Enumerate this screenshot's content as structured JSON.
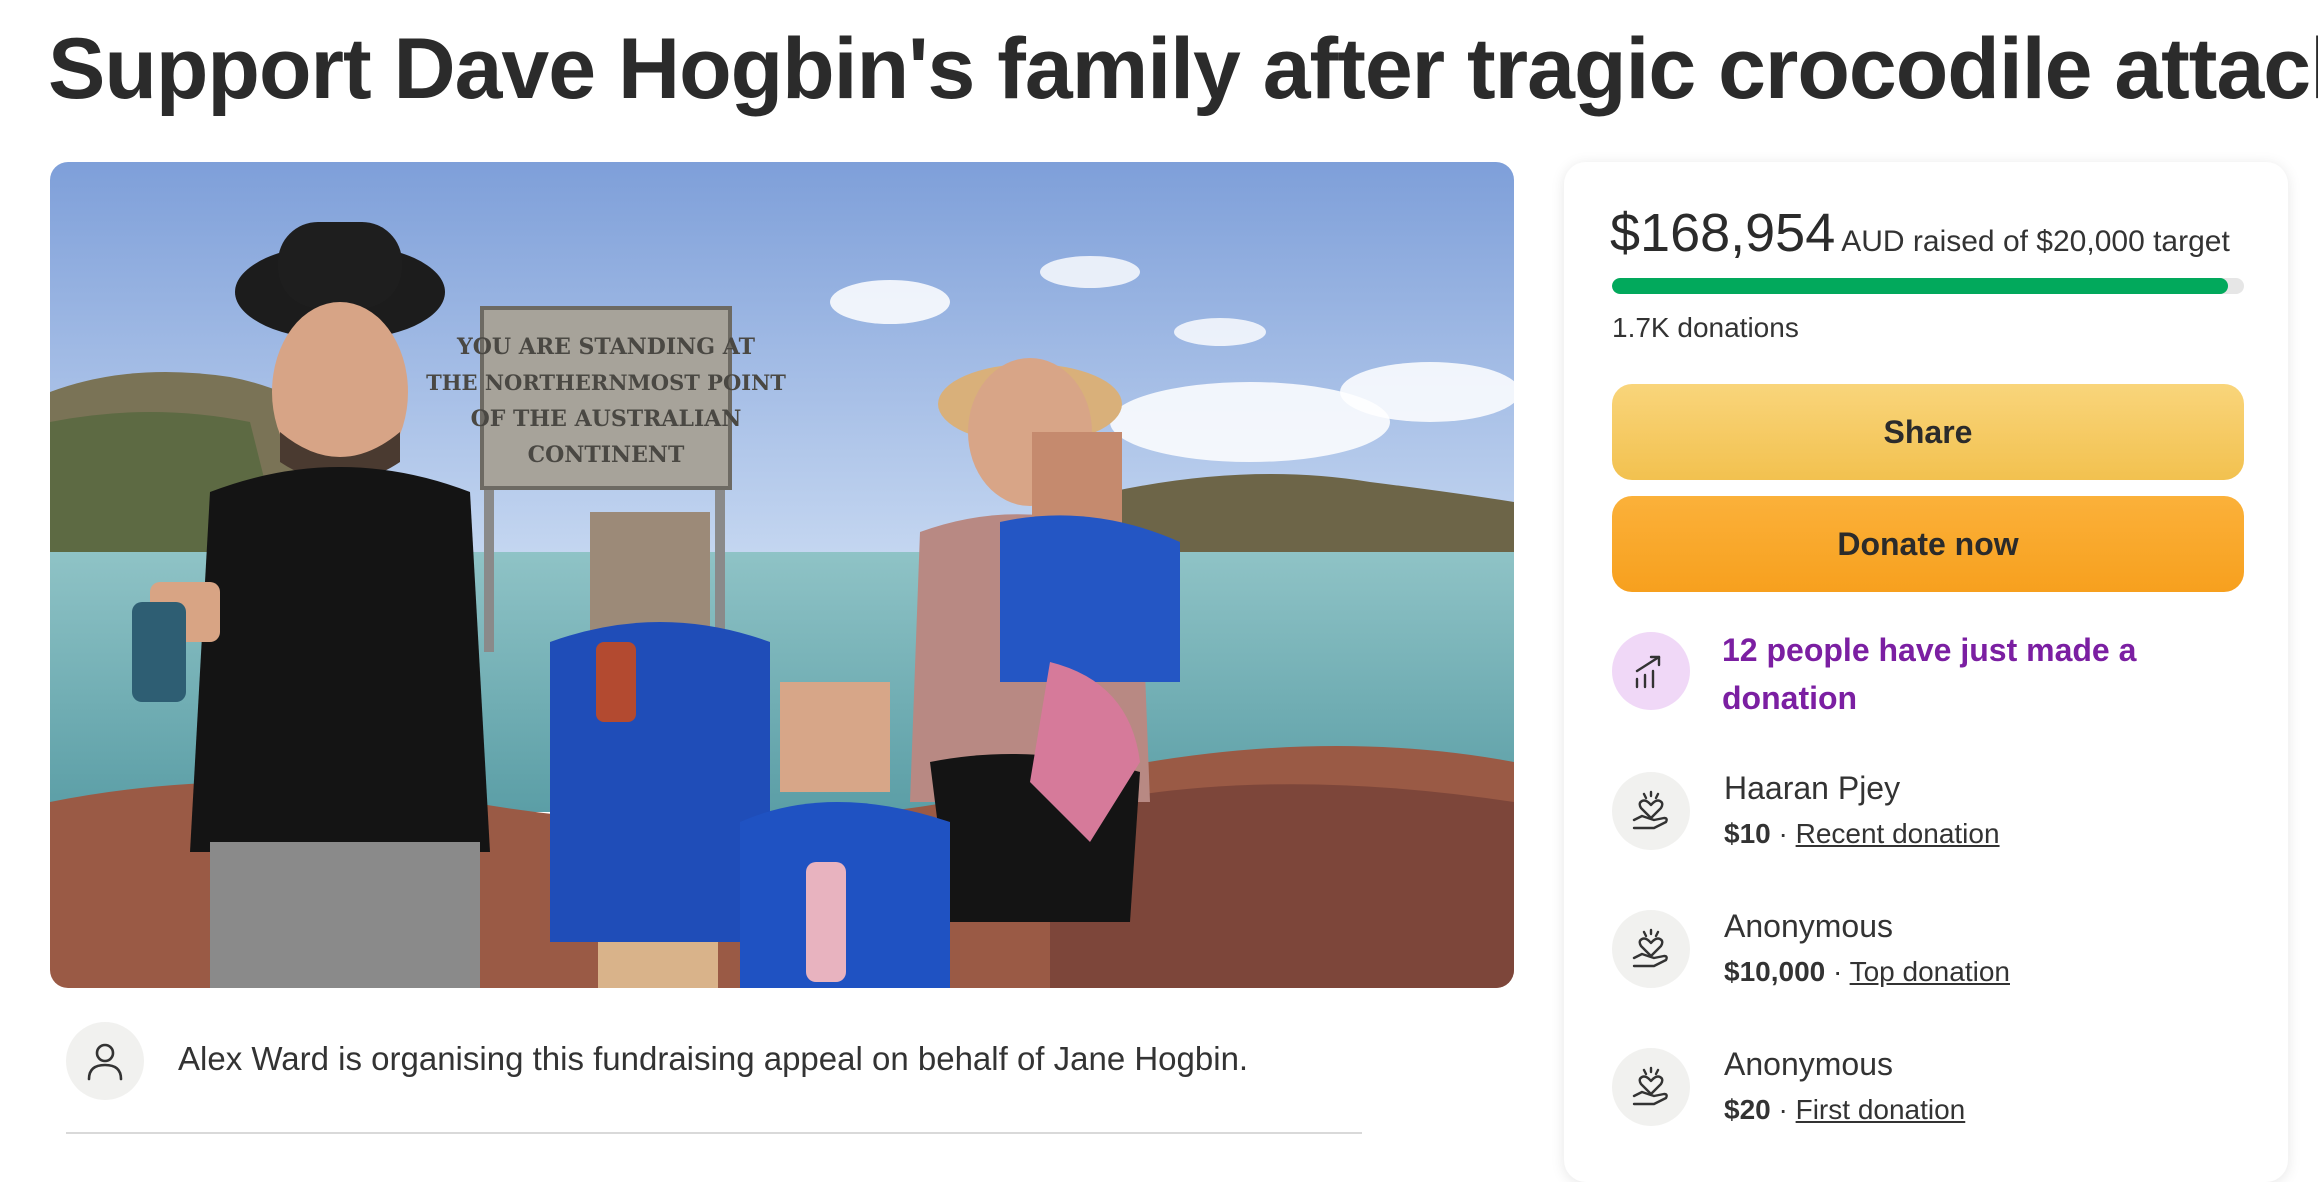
{
  "page": {
    "title": "Support Dave Hogbin's family after tragic crocodile attack"
  },
  "photo": {
    "sign_lines": [
      "YOU ARE STANDING AT",
      "THE NORTHERNMOST POINT",
      "OF THE AUSTRALIAN",
      "CONTINENT"
    ]
  },
  "organiser": {
    "text": "Alex Ward is organising this fundraising appeal on behalf of Jane Hogbin.",
    "icon": "person-icon"
  },
  "campaign": {
    "amount_raised": "$168,954",
    "amount_suffix": "AUD raised of $20,000 target",
    "progress_fraction": 0.975,
    "progress_color": "#02a95c",
    "donations_count": "1.7K donations"
  },
  "buttons": {
    "share_label": "Share",
    "donate_label": "Donate now"
  },
  "momentum": {
    "text": "12 people have just made a donation",
    "icon": "trending-up-icon",
    "color": "#7b1fa2"
  },
  "donations": [
    {
      "name": "Haaran Pjey",
      "amount": "$10",
      "separator": "·",
      "type": "Recent donation",
      "icon": "heart-hand-icon"
    },
    {
      "name": "Anonymous",
      "amount": "$10,000",
      "separator": "·",
      "type": "Top donation",
      "icon": "heart-hand-icon"
    },
    {
      "name": "Anonymous",
      "amount": "$20",
      "separator": "·",
      "type": "First donation",
      "icon": "heart-hand-icon"
    }
  ]
}
